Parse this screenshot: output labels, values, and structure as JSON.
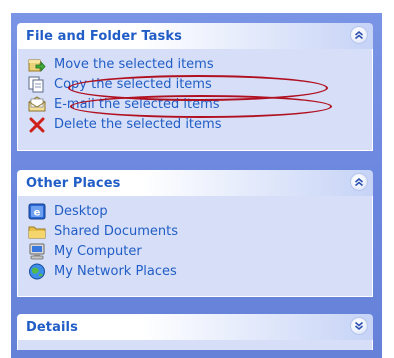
{
  "panels": {
    "file_tasks": {
      "title": "File and Folder Tasks",
      "toggle_icon": "collapse-up-icon",
      "items": [
        {
          "label": "Move the selected items",
          "icon": "move-icon"
        },
        {
          "label": "Copy the selected items",
          "icon": "copy-icon"
        },
        {
          "label": "E-mail the selected items",
          "icon": "email-icon"
        },
        {
          "label": "Delete the selected items",
          "icon": "delete-icon"
        }
      ]
    },
    "other_places": {
      "title": "Other Places",
      "toggle_icon": "collapse-up-icon",
      "items": [
        {
          "label": "Desktop",
          "icon": "desktop-icon"
        },
        {
          "label": "Shared Documents",
          "icon": "folder-icon"
        },
        {
          "label": "My Computer",
          "icon": "computer-icon"
        },
        {
          "label": "My Network Places",
          "icon": "network-icon"
        }
      ]
    },
    "details": {
      "title": "Details",
      "toggle_icon": "expand-down-icon"
    }
  },
  "colors": {
    "background": "#6b86de",
    "link": "#215dc6",
    "panel_body": "#d6dff7",
    "annotation": "#b01020"
  }
}
